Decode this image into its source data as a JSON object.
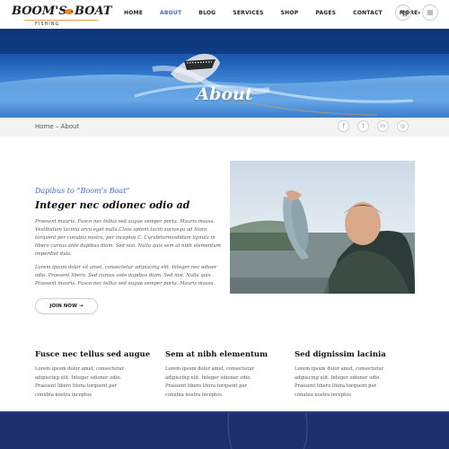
{
  "header": {
    "logo_left": "BOOM'S",
    "logo_right": "BOAT",
    "logo_sub": "FISHING",
    "nav": [
      "HOME",
      "ABOUT",
      "BLOG",
      "SERVICES",
      "SHOP",
      "PAGES",
      "CONTACT",
      "MORE"
    ],
    "active_nav": "ABOUT",
    "more_caret": "▾",
    "cart_icon": "cart-icon",
    "menu_icon": "menu-icon"
  },
  "hero": {
    "title": "About"
  },
  "breadcrumb": {
    "text": "Home – About",
    "social": [
      "f",
      "t",
      "in",
      "◎"
    ]
  },
  "about": {
    "pretitle": "Dapibus to “Boom’s Boat”",
    "title": "Integer nec odionec odio ad",
    "p1": "Praesent mauris. Fusce nec tellus sed augue semper porta. Mauris massa. Vestibulum lacinia arcu eget nulla.Class aptent taciti sociosqu ad litora torquent per conubia nostra, per inceptos C. Curabiturnosdidam lignula in libero cursus ante dapibus diam. Sed nisi. Nulla quis sem at nibh elementum imperdiet duis.",
    "p2": "Lorem ipsum dolor sit amet, consectetur adipiscing elit. Integer nec odioer odio. Praesent libero. Sed cursus ante dapibus diam. Sed nisi. Nulla quis Praesent mauris. Fusce nec tellus sed augue semper porta. Mauris massa.",
    "button": "JOIN NOW →"
  },
  "features": [
    {
      "title": "Fusce nec tellus sed augue",
      "text": "Lorem ipsum dolor amet, consectetur adipiscing elit. Integer odioner odio. Praesent libero litora torquent per conubia nostra inceptos"
    },
    {
      "title": "Sem at nibh elementum",
      "text": "Lorem ipsum dolor amet, consectetur adipiscing elit. Integer odioner odio. Praesent libero litora torquent per conubia nostra inceptos"
    },
    {
      "title": "Sed dignissim lacinia",
      "text": "Lorem ipsum dolor amet, consectetur adipiscing elit. Integer odioner odio. Praesent libero litora torquent per conubia nostra inceptos"
    }
  ],
  "colors": {
    "accent": "#3a6fd8",
    "footer": "#1f2f6b",
    "logo_line": "#e8a24a"
  }
}
